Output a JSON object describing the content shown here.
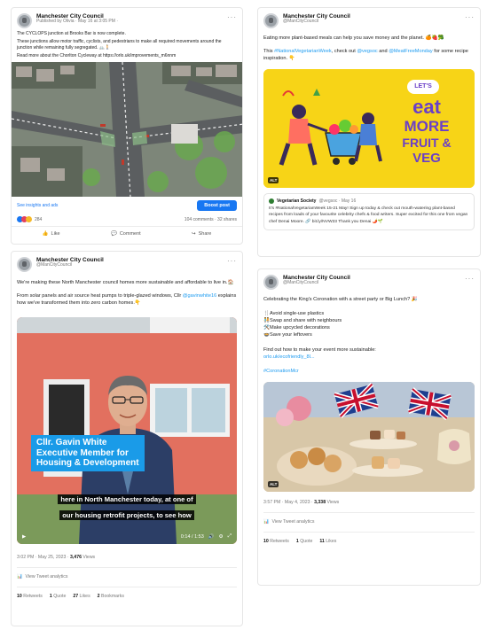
{
  "fb": {
    "name": "Manchester City Council",
    "sub": "Published by Olivia · May 16 at 3:05 PM ·",
    "text1": "The CYCLOPS junction at Brooks Bar is now complete.",
    "text2": "These junctions allow motor traffic, cyclists, and pedestrians to make all required movements around the junction while remaining fully segregated. 🚲🚶",
    "text3": "Read more about the Chorlton Cycleway at https://orlo.uk/improvements_m6nnm",
    "insights": "See insights and ads",
    "boost": "Boost post",
    "reactions": "284",
    "stats": "104 comments · 32 shares",
    "like": "Like",
    "comment": "Comment",
    "share": "Share"
  },
  "t1": {
    "name": "Manchester City Council",
    "handle": "@ManCityCouncil",
    "text1": "We're making these North Manchester council homes more sustainable and affordable to live in.🏠",
    "text2a": "From solar panels and air source heat pumps to triple-glazed windows, Cllr ",
    "mention": "@gavinwhite16",
    "text2b": " explains how we've transformed them into zero carbon homes.👇",
    "lower1": "Cllr. Gavin White",
    "lower2": "Executive Member for",
    "lower3": "Housing & Development",
    "caption1": "here in North Manchester today, at one of",
    "caption2": "our housing retrofit projects, to see how",
    "time": "0:14 / 1:53",
    "meta": "3:02 PM · May 25, 2023 · ",
    "views": "3,476",
    "views_label": " Views",
    "analytics": "View Tweet analytics",
    "retweets": "10",
    "retweets_label": " Retweets",
    "quotes": "1",
    "quotes_label": " Quote",
    "likes": "27",
    "likes_label": " Likes",
    "bookmarks": "2",
    "bookmarks_label": " Bookmarks"
  },
  "t2": {
    "name": "Manchester City Council",
    "handle": "@ManCityCouncil",
    "text1": "Eating more plant-based meals can help you save money and the planet. 🍊🍓🥦",
    "text2a": "This ",
    "hashtag": "#NationalVegetarianWeek",
    "text2b": ", check out ",
    "mention": "@vegsoc",
    "text2c": " and ",
    "mention2": "@MeatFreeMonday",
    "text2d": " for some recipe inspiration. 👇",
    "lets": "LET'S",
    "eat": "eat",
    "more": "MORE",
    "fruit": "FRUIT &",
    "veg": "VEG",
    "alt": "ALT",
    "quote_name": "Vegetarian Society",
    "quote_meta": "@vegsoc · May 16",
    "quote_text": "It's #NationalVegetarianWeek 15-21 May! Sign up today & check out mouth-watering plant-based recipes from loads of your favourite celebrity chefs & food writers. Super excited for this one from vegan chef Denai Moore. 🔗 bit.ly/NVW23 Thank you Denai 🌶️🌱"
  },
  "t3": {
    "name": "Manchester City Council",
    "handle": "@ManCityCouncil",
    "text1": "Celebrating the King's Coronation with a street party or Big Lunch? 🎉",
    "b1": "🍴Avoid single-use plastics",
    "b2": "🧑‍🤝‍🧑Swap and share with neighbours",
    "b3": "🛠️Make upcycled decorations",
    "b4": "🍲Save your leftovers",
    "text2": "Find out how to make your event more sustainable:",
    "link": "orlo.uk/ecofriendly_8l...",
    "hashtag": "#CoronationMcr",
    "alt": "ALT",
    "meta": "3:57 PM · May 4, 2023 · ",
    "views": "3,338",
    "views_label": " Views",
    "analytics": "View Tweet analytics",
    "retweets": "10",
    "retweets_label": " Retweets",
    "quotes": "1",
    "quotes_label": " Quote",
    "likes": "11",
    "likes_label": " Likes"
  },
  "colors": {
    "link": "#1d9bf0",
    "boost": "#1877f2",
    "veg_yellow": "#f7d417",
    "caption_blue": "#1a9be8"
  },
  "icons": [
    "globe-icon",
    "more-icon",
    "like-icon",
    "comment-icon",
    "share-icon",
    "play-icon",
    "volume-icon",
    "settings-icon",
    "fullscreen-icon",
    "analytics-icon"
  ]
}
